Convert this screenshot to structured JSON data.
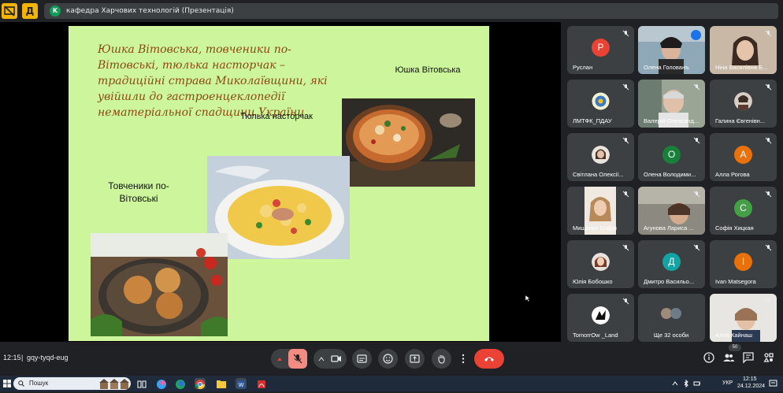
{
  "titlebar": {
    "chip_letter": "K",
    "presentation_title": "кафедра Харчових технологій (Презентація)",
    "btn2_letter": "Д"
  },
  "slide": {
    "main_text": "Юшка Вітовська, товченики по-Вітовські, тюлька насторчак – традиційні страва Миколаївщини, які увійшли до гастроенцеклопедії  нематеріальної спадщини  України",
    "label_yushka": "Юшка Вітовська",
    "label_tyulka": "Тюлька насторчак",
    "label_tovcheniki": "Товченики по-Вітовські",
    "colors": {
      "background": "#ccf59c",
      "title": "#8b4a10"
    }
  },
  "participants": [
    {
      "name": "Руслан",
      "initial": "Р",
      "color": "#ea4335",
      "muted": true
    },
    {
      "name": "Олена Голованъ",
      "initial": "",
      "color": "",
      "muted": false,
      "speaking": true
    },
    {
      "name": "Ніна Василівна Б...",
      "initial": "",
      "color": "",
      "muted": true
    },
    {
      "name": "ЛМТФК_ПДАУ",
      "initial": "",
      "color": "",
      "muted": true
    },
    {
      "name": "Валерій Олександ...",
      "initial": "",
      "color": "",
      "muted": true
    },
    {
      "name": "Галина Євгенівн...",
      "initial": "",
      "color": "",
      "muted": true
    },
    {
      "name": "Світлана Олексії...",
      "initial": "",
      "color": "",
      "muted": true
    },
    {
      "name": "Олена Володими...",
      "initial": "О",
      "color": "#188038",
      "muted": true
    },
    {
      "name": "Алла Рогова",
      "initial": "А",
      "color": "#e8710a",
      "muted": true
    },
    {
      "name": "Мищенко Софія",
      "initial": "",
      "color": "",
      "muted": true
    },
    {
      "name": "Агунова Лариса ...",
      "initial": "",
      "color": "",
      "muted": true
    },
    {
      "name": "Софія Хицкая",
      "initial": "С",
      "color": "#43a047",
      "muted": true
    },
    {
      "name": "Юлія Бобошко",
      "initial": "",
      "color": "",
      "muted": true
    },
    {
      "name": "Дмитро Васильо...",
      "initial": "Д",
      "color": "#12a4a4",
      "muted": true
    },
    {
      "name": "Ivan Matsegora",
      "initial": "I",
      "color": "#e8710a",
      "muted": true
    },
    {
      "name": "TomorrOw _Land",
      "initial": "",
      "color": "",
      "muted": true
    },
    {
      "name": "Ще 32 особи",
      "initial": "",
      "color": "",
      "muted": false
    },
    {
      "name": "Алла Кайнаш",
      "initial": "",
      "color": "",
      "muted": true
    }
  ],
  "meeting": {
    "time": "12:15",
    "separator": "|",
    "code": "gqy-tyqd-eug",
    "people_count": "50"
  },
  "taskbar": {
    "search_placeholder": "Пошук",
    "language": "УКР",
    "clock_time": "12:15",
    "clock_date": "24.12.2024"
  }
}
